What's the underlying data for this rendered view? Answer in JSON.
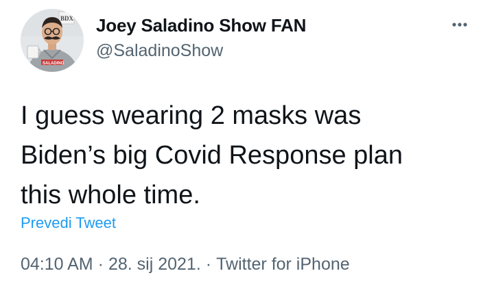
{
  "author": {
    "display_name": "Joey Saladino Show FAN",
    "handle": "@SaladinoShow",
    "avatar_sign_text": "BDX",
    "avatar_shirt_text": "SALADINO"
  },
  "tweet": {
    "text": "I guess wearing 2 masks was\nBiden’s big Covid Response plan\nthis whole time."
  },
  "actions": {
    "translate_label": "Prevedi Tweet",
    "more_icon": "more-horizontal-icon"
  },
  "meta": {
    "time": "04:10 AM",
    "separator": "·",
    "date": "28. sij 2021.",
    "source": "Twitter for iPhone"
  },
  "colors": {
    "text_primary": "#0f1419",
    "text_secondary": "#536471",
    "link": "#1d9bf0",
    "background": "#ffffff"
  }
}
